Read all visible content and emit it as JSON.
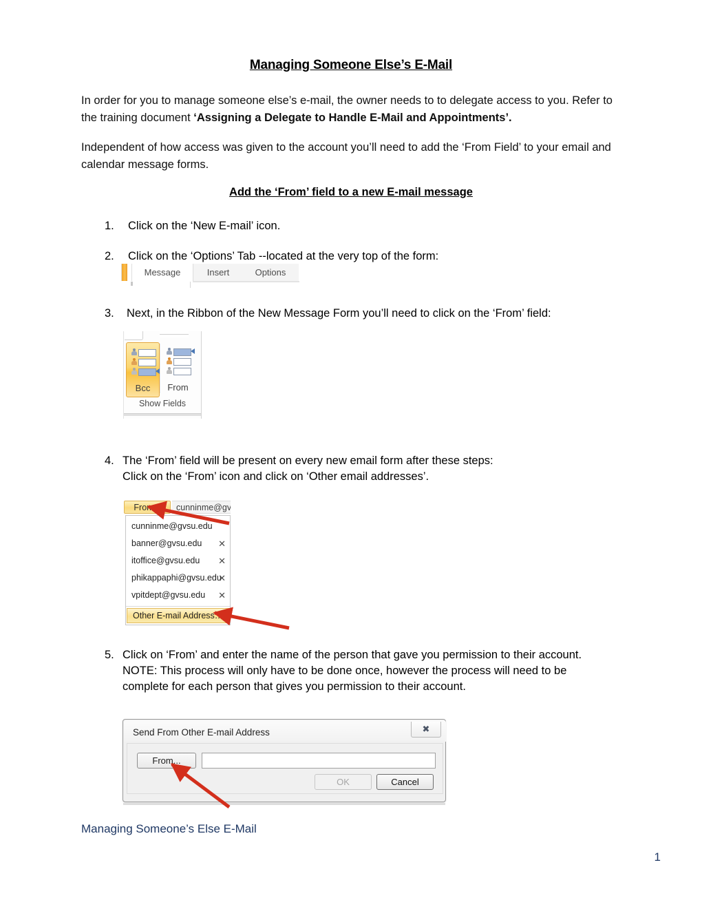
{
  "document": {
    "title": "Managing Someone Else’s E-Mail",
    "intro_paragraph_1_a": "In order for you to manage someone else’s e-mail, the owner needs to to delegate access to you.  Refer to the training document ",
    "intro_paragraph_1_b": "‘Assigning a Delegate to Handle E-Mail and Appointments’.",
    "intro_paragraph_2": "Independent of how access was given to the account you’ll need to add the ‘From Field’ to your email and calendar message forms.",
    "section_heading": "Add the ‘From’ field to a new E-mail message",
    "steps": [
      {
        "number": "1.",
        "text": "Click on the ‘New E-mail’ icon."
      },
      {
        "number": "2.",
        "text": "Click on the ‘Options’ Tab --located at the very top of the form:"
      },
      {
        "number": "3.",
        "text": "Next, in the Ribbon of the New Message Form you’ll need to click on the ‘From’ field:"
      },
      {
        "number": "4.",
        "line1": "The ‘From’ field will be present on every new email form after these steps:",
        "line2": "Click on the ‘From’ icon and click on ‘Other email addresses’."
      },
      {
        "number": "5.",
        "line1": "Click on ‘From’ and enter the name of the person that gave you permission to their account.",
        "line2": "NOTE: This process will only have to be done once, however the process will need to be",
        "line3": "complete for each person that gives you permission to their account."
      }
    ],
    "footer_text": "Managing Someone’s Else E-Mail",
    "page_number": "1"
  },
  "screenshot_tabs": {
    "tabs": [
      {
        "label": "Message"
      },
      {
        "label": "Insert"
      },
      {
        "label": "Options"
      }
    ]
  },
  "screenshot_ribbon": {
    "bcc_label": "Bcc",
    "from_label": "From",
    "group_label": "Show Fields"
  },
  "screenshot_dropdown": {
    "from_button_label": "From",
    "address_bar_value": "cunninme@gv",
    "items": [
      {
        "label": "cunninme@gvsu.edu",
        "remove": ""
      },
      {
        "label": "banner@gvsu.edu",
        "remove": "✕"
      },
      {
        "label": "itoffice@gvsu.edu",
        "remove": "✕"
      },
      {
        "label": "phikappaphi@gvsu.edu",
        "remove": "✕"
      },
      {
        "label": "vpitdept@gvsu.edu",
        "remove": "✕"
      }
    ],
    "other_item_label": "Other E-mail Address…"
  },
  "screenshot_dialog": {
    "title": "Send From Other E-mail Address",
    "close_glyph": "✖",
    "from_button_label": "From...",
    "input_value": "",
    "ok_label": "OK",
    "cancel_label": "Cancel"
  },
  "colors": {
    "accent_yellow": "#fbda7d",
    "arrow_red": "#d32f1c",
    "footer_blue": "#1f3864"
  }
}
